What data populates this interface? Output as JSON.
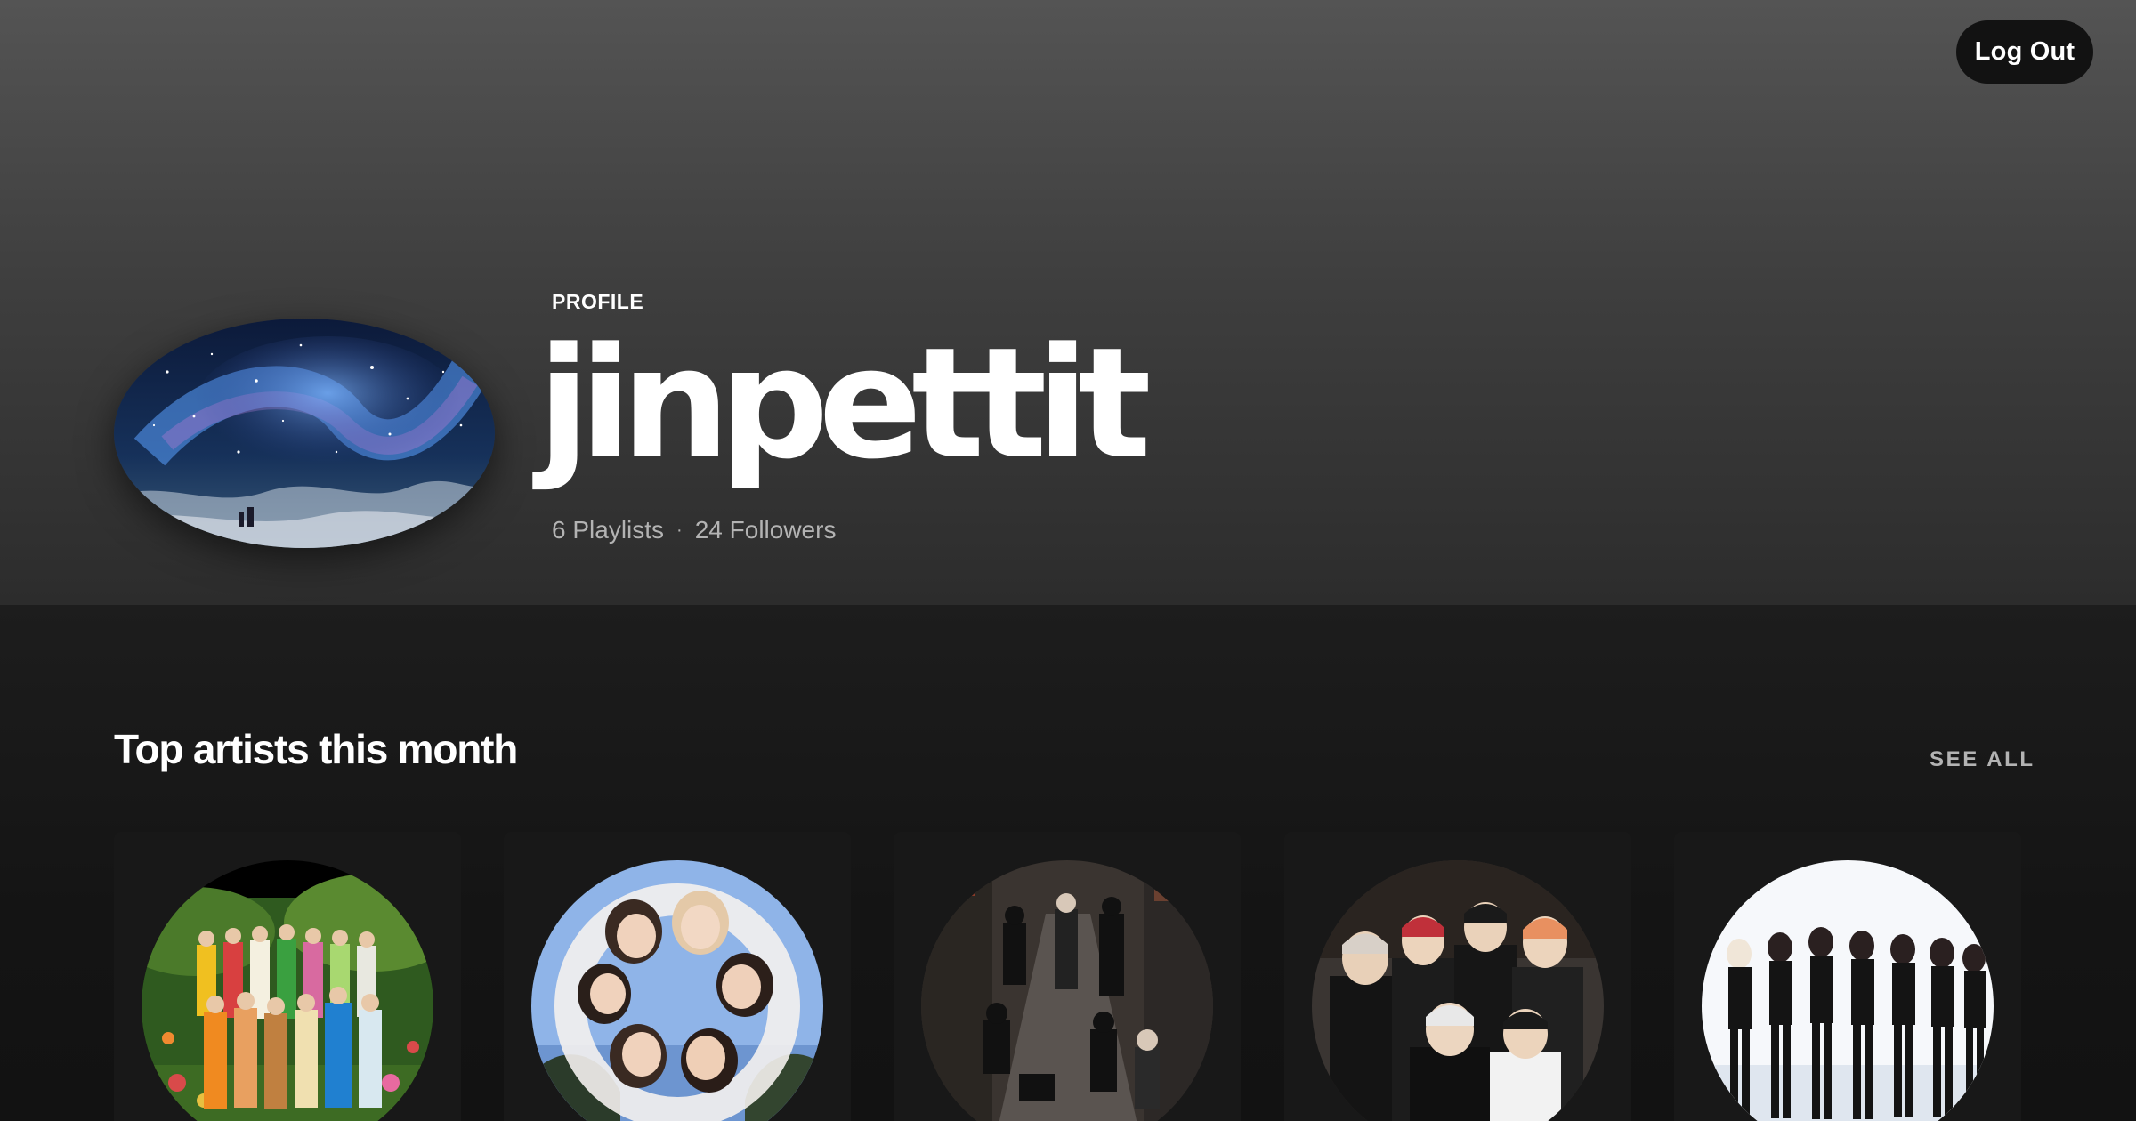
{
  "header": {
    "logout_label": "Log Out"
  },
  "profile": {
    "label": "PROFILE",
    "name": "jinpettit",
    "playlists": "6 Playlists",
    "separator": "·",
    "followers": "24 Followers"
  },
  "top_artists": {
    "title": "Top artists this month",
    "see_all_label": "SEE ALL"
  },
  "colors": {
    "background": "#121212",
    "card": "#181818",
    "secondary_text": "#b3b3b3"
  }
}
